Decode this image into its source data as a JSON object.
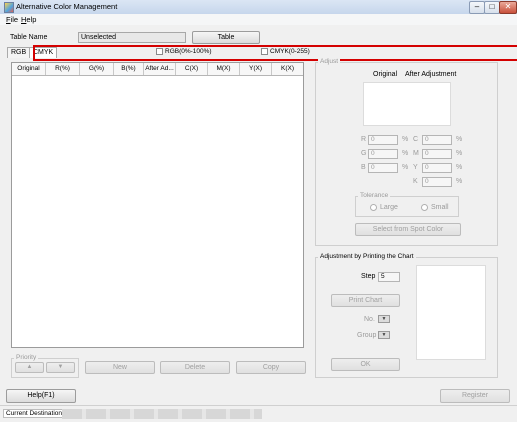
{
  "window": {
    "title": "Alternative Color Management"
  },
  "menu": [
    {
      "label": "File",
      "underline": "F",
      "rest": "ile"
    },
    {
      "label": "Help",
      "underline": "H",
      "rest": "elp"
    }
  ],
  "table_name": {
    "label": "Table Name",
    "value": "Unselected",
    "button": "Table"
  },
  "tabs": [
    "RGB",
    "CMYK"
  ],
  "checkboxes": [
    "RGB(0%-100%)",
    "CMYK(0-255)"
  ],
  "table": {
    "columns": [
      "Original",
      "R(%)",
      "G(%)",
      "B(%)",
      "After Ad...",
      "C(X)",
      "M(X)",
      "Y(X)",
      "K(X)"
    ]
  },
  "priority": {
    "label": "Priority",
    "up": "▲",
    "down": "▼"
  },
  "actions": {
    "new": "New",
    "delete": "Delete",
    "copy": "Copy"
  },
  "adjust": {
    "title": "Adjust",
    "original": "Original",
    "after": "After Adjustment",
    "rows": [
      {
        "left": "R",
        "lv": "0",
        "right": "C",
        "rv": "0"
      },
      {
        "left": "G",
        "lv": "0",
        "right": "M",
        "rv": "0"
      },
      {
        "left": "B",
        "lv": "0",
        "right": "Y",
        "rv": "0"
      },
      {
        "left": "",
        "lv": "",
        "right": "K",
        "rv": "0"
      }
    ],
    "pct": "%",
    "tolerance": {
      "title": "Tolerance",
      "large": "Large",
      "small": "Small"
    },
    "select_button": "Select from Spot Color"
  },
  "chart": {
    "title": "Adjustment by Printing the Chart",
    "step_label": "Step",
    "step_value": "5",
    "print_button": "Print Chart",
    "no_label": "No.",
    "group_label": "Group",
    "ok_button": "OK"
  },
  "help_button": "Help(F1)",
  "register_button": "Register",
  "status": {
    "label": "Current Destination"
  }
}
